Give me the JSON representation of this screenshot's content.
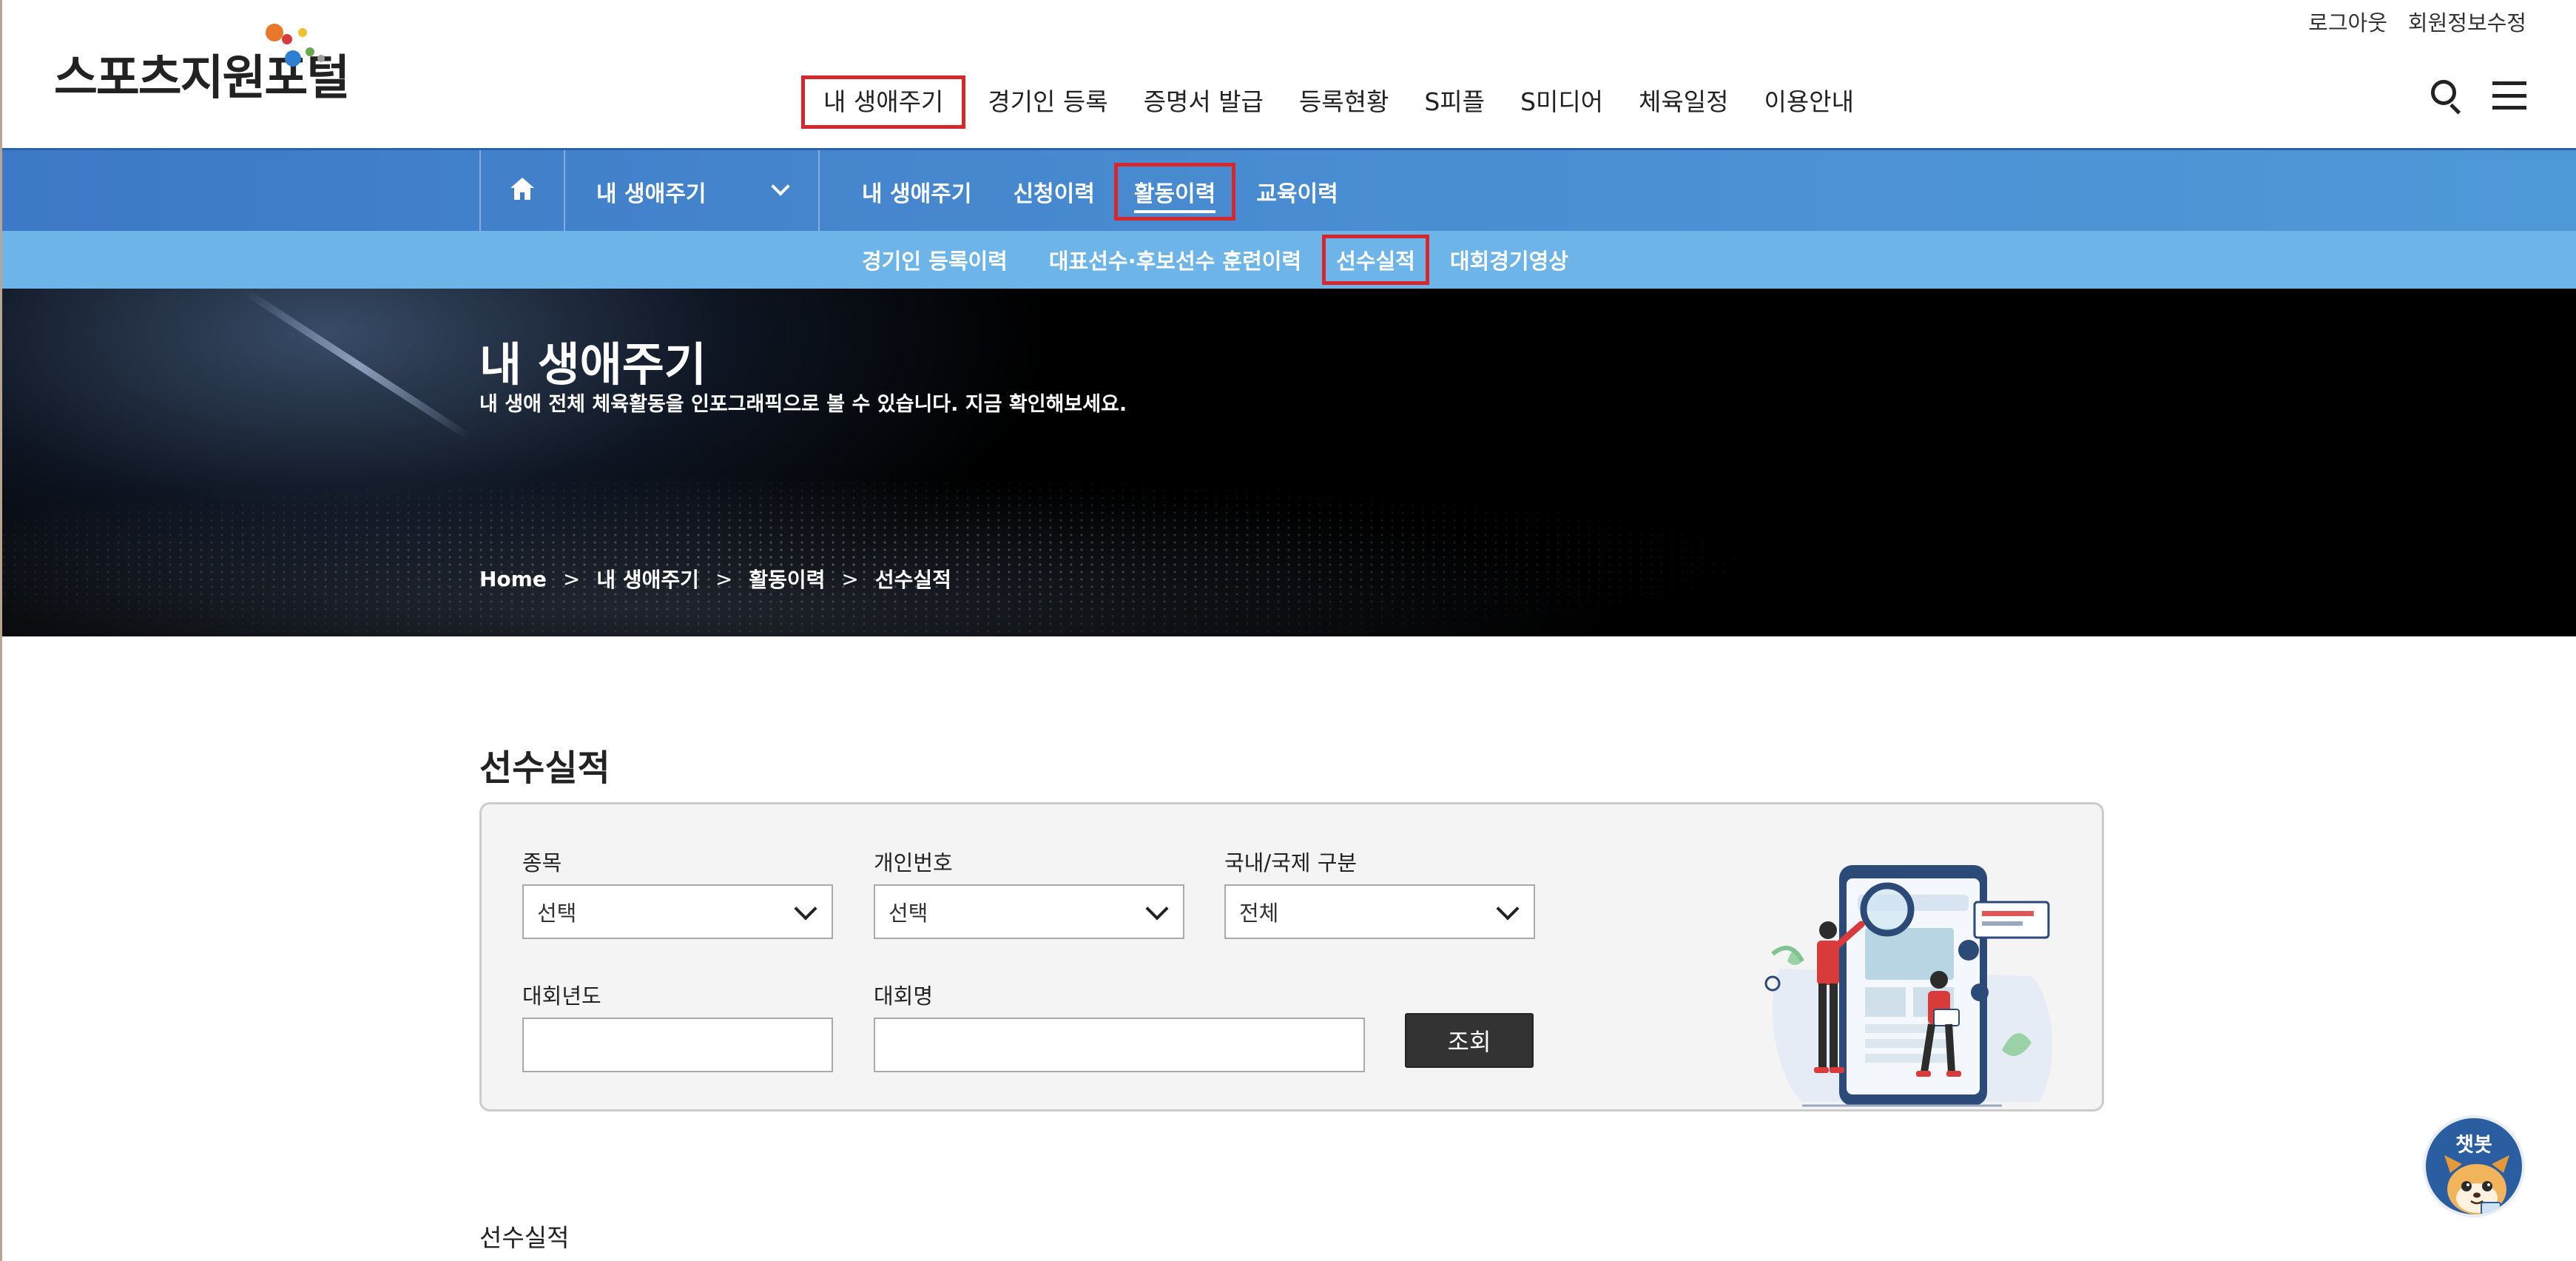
{
  "header": {
    "logo_text": "스포츠지원포털",
    "util_links": [
      "로그아웃",
      "회원정보수정"
    ],
    "gnb": [
      {
        "label": "내 생애주기",
        "active": true
      },
      {
        "label": "경기인 등록"
      },
      {
        "label": "증명서 발급"
      },
      {
        "label": "등록현황"
      },
      {
        "label": "S피플"
      },
      {
        "label": "S미디어"
      },
      {
        "label": "체육일정"
      },
      {
        "label": "이용안내"
      }
    ]
  },
  "subnav": {
    "dropdown": "내 생애주기",
    "tabs": [
      {
        "label": "내 생애주기"
      },
      {
        "label": "신청이력"
      },
      {
        "label": "활동이력",
        "active": true
      },
      {
        "label": "교육이력"
      }
    ],
    "sub_tabs": [
      {
        "label": "경기인 등록이력"
      },
      {
        "label": "대표선수·후보선수 훈련이력"
      },
      {
        "label": "선수실적",
        "active": true
      },
      {
        "label": "대회경기영상"
      }
    ]
  },
  "hero": {
    "title": "내 생애주기",
    "description": "내 생애 전체 체육활동을 인포그래픽으로 볼 수 있습니다. 지금 확인해보세요.",
    "breadcrumb": [
      "Home",
      "내 생애주기",
      "활동이력",
      "선수실적"
    ],
    "separator": ">"
  },
  "main": {
    "page_title": "선수실적",
    "form": {
      "sport": {
        "label": "종목",
        "value": "선택"
      },
      "personal_no": {
        "label": "개인번호",
        "value": "선택"
      },
      "region": {
        "label": "국내/국제 구분",
        "value": "전체"
      },
      "year": {
        "label": "대회년도",
        "value": ""
      },
      "competition": {
        "label": "대회명",
        "value": ""
      },
      "submit": "조회"
    },
    "section_label": "선수실적"
  },
  "chatbot": {
    "label": "챗봇"
  },
  "colors": {
    "primary_blue": "#3d79c6",
    "sub_blue": "#6db4e8",
    "highlight_red": "#d7262c",
    "button_dark": "#333333"
  }
}
